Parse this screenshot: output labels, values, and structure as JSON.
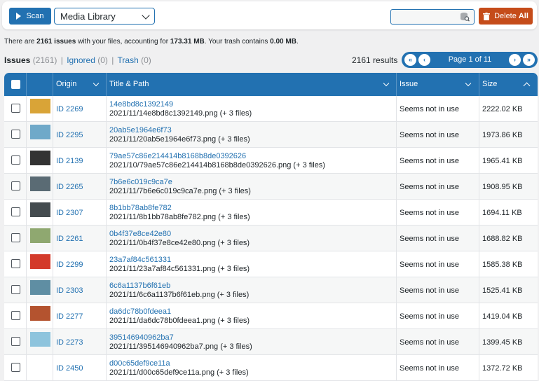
{
  "toolbar": {
    "scan_label": "Scan",
    "media_select_value": "Media Library",
    "search_placeholder": "",
    "delete_label": "Delete",
    "delete_label_bold": "All"
  },
  "summary": {
    "prefix": "There are ",
    "issues_count": "2161 issues",
    "mid": " with your files, accounting for ",
    "size": "173.31 MB",
    "mid2": ". Your trash contains ",
    "trash": "0.00 MB",
    "end": "."
  },
  "tabs": {
    "issues_label": "Issues",
    "issues_count": "(2161)",
    "ignored_label": "Ignored",
    "ignored_count": "(0)",
    "trash_label": "Trash",
    "trash_count": "(0)",
    "sep": "|"
  },
  "results_label": "2161 results",
  "pager": {
    "label": "Page 1 of 11",
    "first": "«",
    "prev": "‹",
    "next": "›",
    "last": "»"
  },
  "columns": {
    "origin": "Origin",
    "title": "Title & Path",
    "issue": "Issue",
    "size": "Size"
  },
  "colors": {
    "accent": "#2271b1",
    "delete": "#c54c1a"
  },
  "rows": [
    {
      "origin": "ID 2269",
      "title": "14e8bd8c1392149",
      "path": "2021/11/14e8bd8c1392149.png (+ 3 files)",
      "issue": "Seems not in use",
      "size": "2222.02 KB",
      "thumb": "#d9a437"
    },
    {
      "origin": "ID 2295",
      "title": "20ab5e1964e6f73",
      "path": "2021/11/20ab5e1964e6f73.png (+ 3 files)",
      "issue": "Seems not in use",
      "size": "1973.86 KB",
      "thumb": "#6fa9c9"
    },
    {
      "origin": "ID 2139",
      "title": "79ae57c86e214414b8168b8de0392626",
      "path": "2021/10/79ae57c86e214414b8168b8de0392626.png (+ 3 files)",
      "issue": "Seems not in use",
      "size": "1965.41 KB",
      "thumb": "#333333"
    },
    {
      "origin": "ID 2265",
      "title": "7b6e6c019c9ca7e",
      "path": "2021/11/7b6e6c019c9ca7e.png (+ 3 files)",
      "issue": "Seems not in use",
      "size": "1908.95 KB",
      "thumb": "#5a6b74"
    },
    {
      "origin": "ID 2307",
      "title": "8b1bb78ab8fe782",
      "path": "2021/11/8b1bb78ab8fe782.png (+ 3 files)",
      "issue": "Seems not in use",
      "size": "1694.11 KB",
      "thumb": "#444b4f"
    },
    {
      "origin": "ID 2261",
      "title": "0b4f37e8ce42e80",
      "path": "2021/11/0b4f37e8ce42e80.png (+ 3 files)",
      "issue": "Seems not in use",
      "size": "1688.82 KB",
      "thumb": "#8fa870"
    },
    {
      "origin": "ID 2299",
      "title": "23a7af84c561331",
      "path": "2021/11/23a7af84c561331.png (+ 3 files)",
      "issue": "Seems not in use",
      "size": "1585.38 KB",
      "thumb": "#d33a2a"
    },
    {
      "origin": "ID 2303",
      "title": "6c6a1137b6f61eb",
      "path": "2021/11/6c6a1137b6f61eb.png (+ 3 files)",
      "issue": "Seems not in use",
      "size": "1525.41 KB",
      "thumb": "#5f8ea3"
    },
    {
      "origin": "ID 2277",
      "title": "da6dc78b0fdeea1",
      "path": "2021/11/da6dc78b0fdeea1.png (+ 3 files)",
      "issue": "Seems not in use",
      "size": "1419.04 KB",
      "thumb": "#b4532f"
    },
    {
      "origin": "ID 2273",
      "title": "395146940962ba7",
      "path": "2021/11/395146940962ba7.png (+ 3 files)",
      "issue": "Seems not in use",
      "size": "1399.45 KB",
      "thumb": "#8ec4dd"
    },
    {
      "origin": "ID 2450",
      "title": "d00c65def9ce11a",
      "path": "2021/11/d00c65def9ce11a.png (+ 3 files)",
      "issue": "Seems not in use",
      "size": "1372.72 KB",
      "thumb": "#ffffff"
    }
  ]
}
